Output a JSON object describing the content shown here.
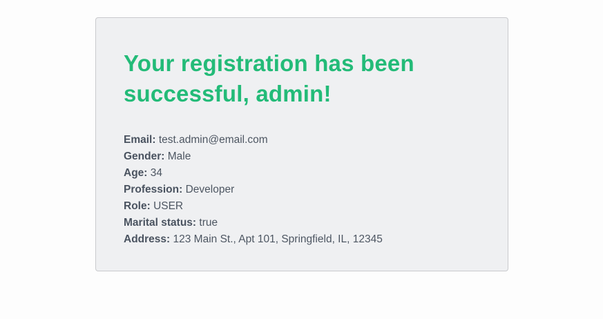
{
  "confirmation": {
    "title": "Your registration has been successful, admin!"
  },
  "details": [
    {
      "label": "Email:",
      "value": "test.admin@email.com"
    },
    {
      "label": "Gender:",
      "value": "Male"
    },
    {
      "label": "Age:",
      "value": "34"
    },
    {
      "label": "Profession:",
      "value": "Developer"
    },
    {
      "label": "Role:",
      "value": "USER"
    },
    {
      "label": "Marital status:",
      "value": "true"
    },
    {
      "label": "Address:",
      "value": "123 Main St., Apt 101, Springfield, IL, 12345"
    }
  ],
  "colors": {
    "title": "#23bb78",
    "card_background": "#eff0f2",
    "card_border": "#c9cacd",
    "text": "#4d5662"
  }
}
